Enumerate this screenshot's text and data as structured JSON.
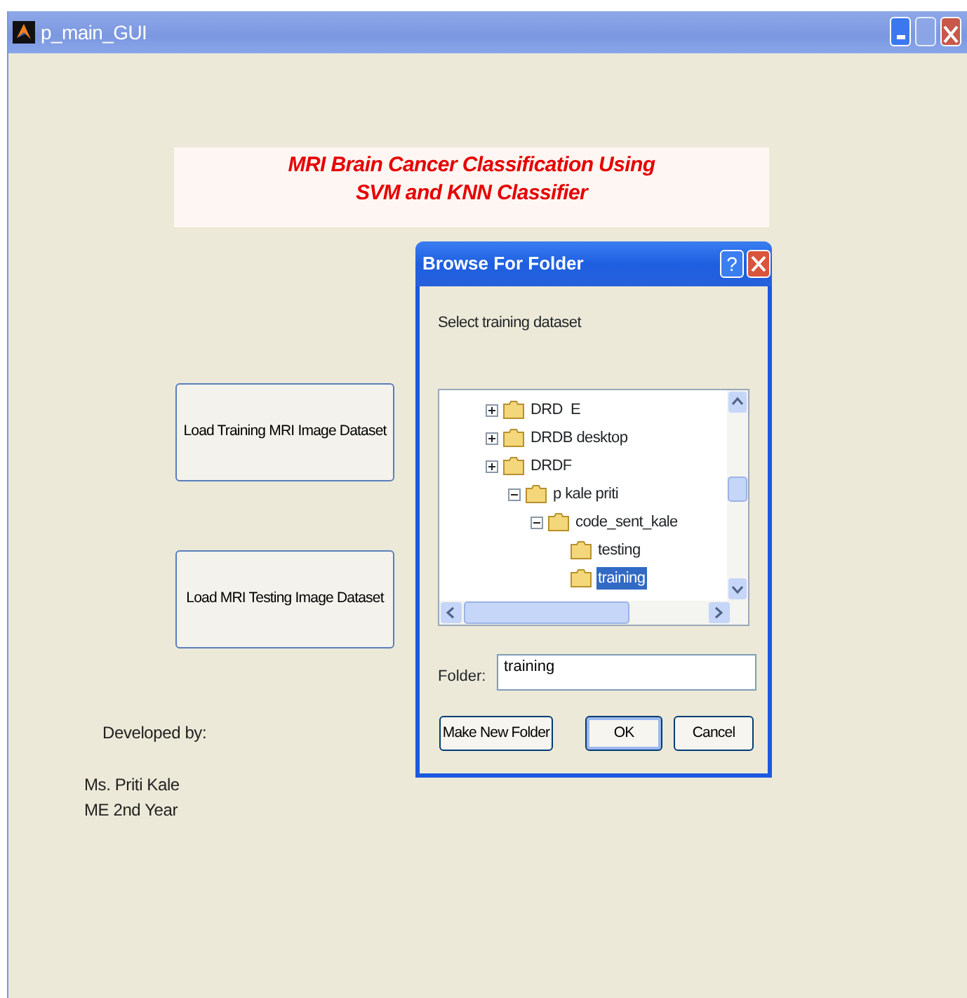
{
  "window": {
    "title": "p_main_GUI"
  },
  "banner": {
    "lines": [
      "MRI Brain Cancer Classification Using",
      "SVM and KNN Classifier"
    ]
  },
  "buttons": [
    "Load Training MRI Image Dataset",
    "Load MRI Testing Image Dataset"
  ],
  "credits": {
    "heading": "Developed by:",
    "lines": [
      "Ms. Priti Kale",
      "ME 2nd Year"
    ]
  },
  "dialog": {
    "title": "Browse For Folder",
    "help_glyph": "?",
    "prompt": "Select training dataset",
    "tree": [
      {
        "label": "DRD  E",
        "expanded": false,
        "selected": false
      },
      {
        "label": "DRDB desktop",
        "expanded": false,
        "selected": false
      },
      {
        "label": "DRDF",
        "expanded": false,
        "selected": false,
        "children": [
          {
            "label": "p kale priti",
            "expanded": true,
            "selected": false,
            "children": [
              {
                "label": "code_sent_kale",
                "expanded": true,
                "selected": false,
                "children": [
                  {
                    "label": "testing",
                    "selected": false
                  },
                  {
                    "label": "training",
                    "selected": true
                  }
                ]
              }
            ]
          }
        ]
      }
    ],
    "folder_label": "Folder:",
    "folder_value": "training",
    "buttons": [
      {
        "label": "Make New Folder",
        "default": false
      },
      {
        "label": "OK",
        "default": true
      },
      {
        "label": "Cancel",
        "default": false
      }
    ]
  }
}
